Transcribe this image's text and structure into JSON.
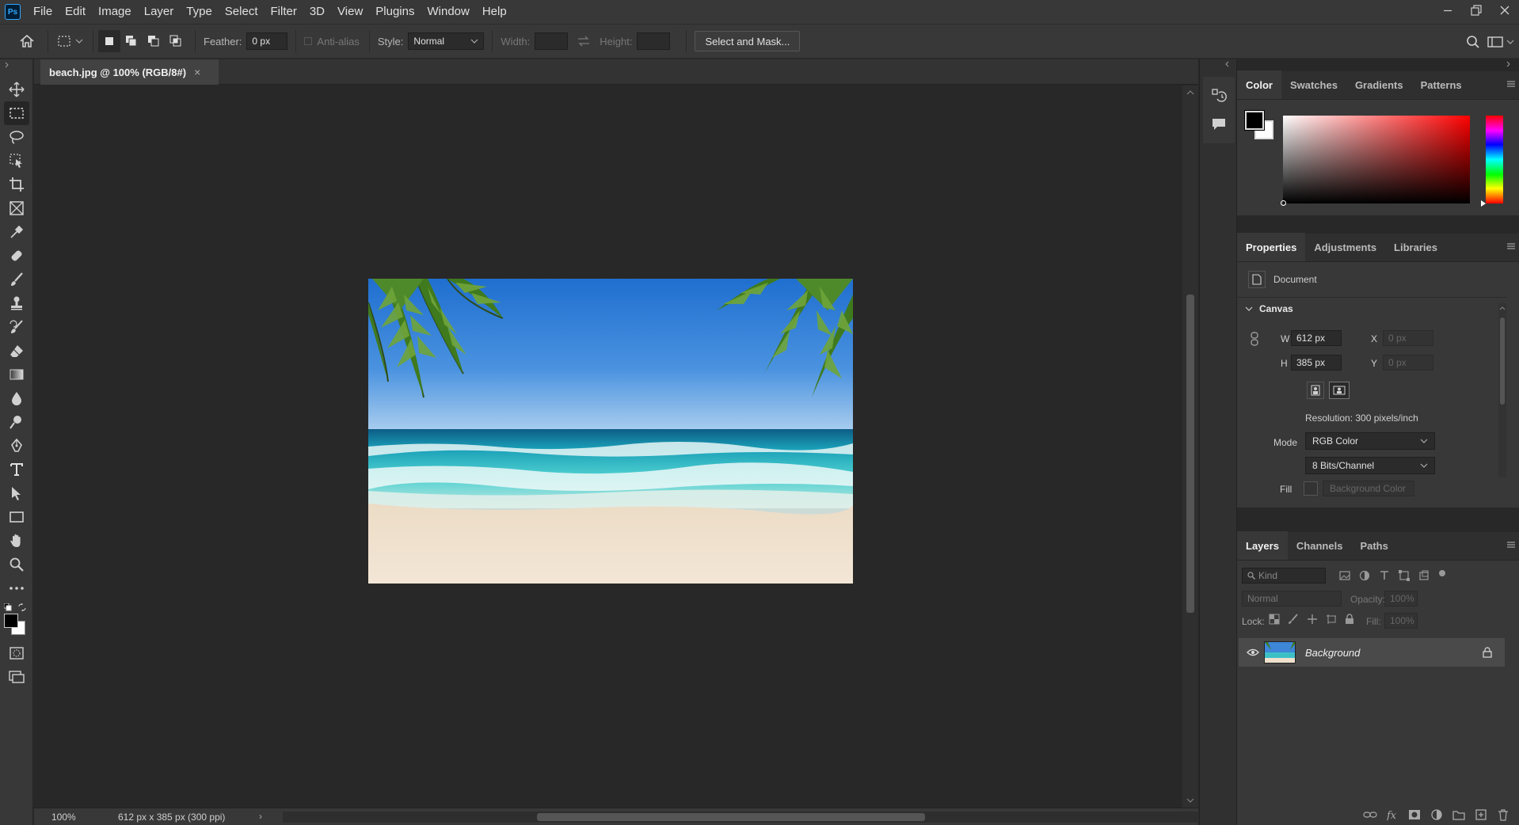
{
  "app": {
    "logo": "Ps"
  },
  "menu": [
    "File",
    "Edit",
    "Image",
    "Layer",
    "Type",
    "Select",
    "Filter",
    "3D",
    "View",
    "Plugins",
    "Window",
    "Help"
  ],
  "options": {
    "feather_label": "Feather:",
    "feather_value": "0 px",
    "antialias_label": "Anti-alias",
    "style_label": "Style:",
    "style_value": "Normal",
    "width_label": "Width:",
    "height_label": "Height:",
    "select_mask_label": "Select and Mask..."
  },
  "document": {
    "tab_title": "beach.jpg @ 100% (RGB/8#)",
    "close_glyph": "×"
  },
  "status": {
    "zoom": "100%",
    "info": "612 px x 385 px (300 ppi)",
    "arrow": "›"
  },
  "color_panel": {
    "tabs": [
      "Color",
      "Swatches",
      "Gradients",
      "Patterns"
    ],
    "foreground": "#000000",
    "background": "#ffffff",
    "selected_hue": "#ff0000"
  },
  "properties_panel": {
    "tabs": [
      "Properties",
      "Adjustments",
      "Libraries"
    ],
    "document_label": "Document",
    "canvas_label": "Canvas",
    "w_label": "W",
    "w_value": "612 px",
    "h_label": "H",
    "h_value": "385 px",
    "x_label": "X",
    "x_value": "0 px",
    "y_label": "Y",
    "y_value": "0 px",
    "resolution": "Resolution: 300 pixels/inch",
    "mode_label": "Mode",
    "mode_value": "RGB Color",
    "bits_value": "8 Bits/Channel",
    "fill_label": "Fill",
    "fill_value": "Background Color"
  },
  "layers_panel": {
    "tabs": [
      "Layers",
      "Channels",
      "Paths"
    ],
    "filter_placeholder": "Kind",
    "blend_mode": "Normal",
    "opacity_label": "Opacity:",
    "opacity_value": "100%",
    "lock_label": "Lock:",
    "fill_label": "Fill:",
    "fill_value": "100%",
    "layers": [
      {
        "name": "Background",
        "visible": true,
        "locked": true
      }
    ]
  }
}
